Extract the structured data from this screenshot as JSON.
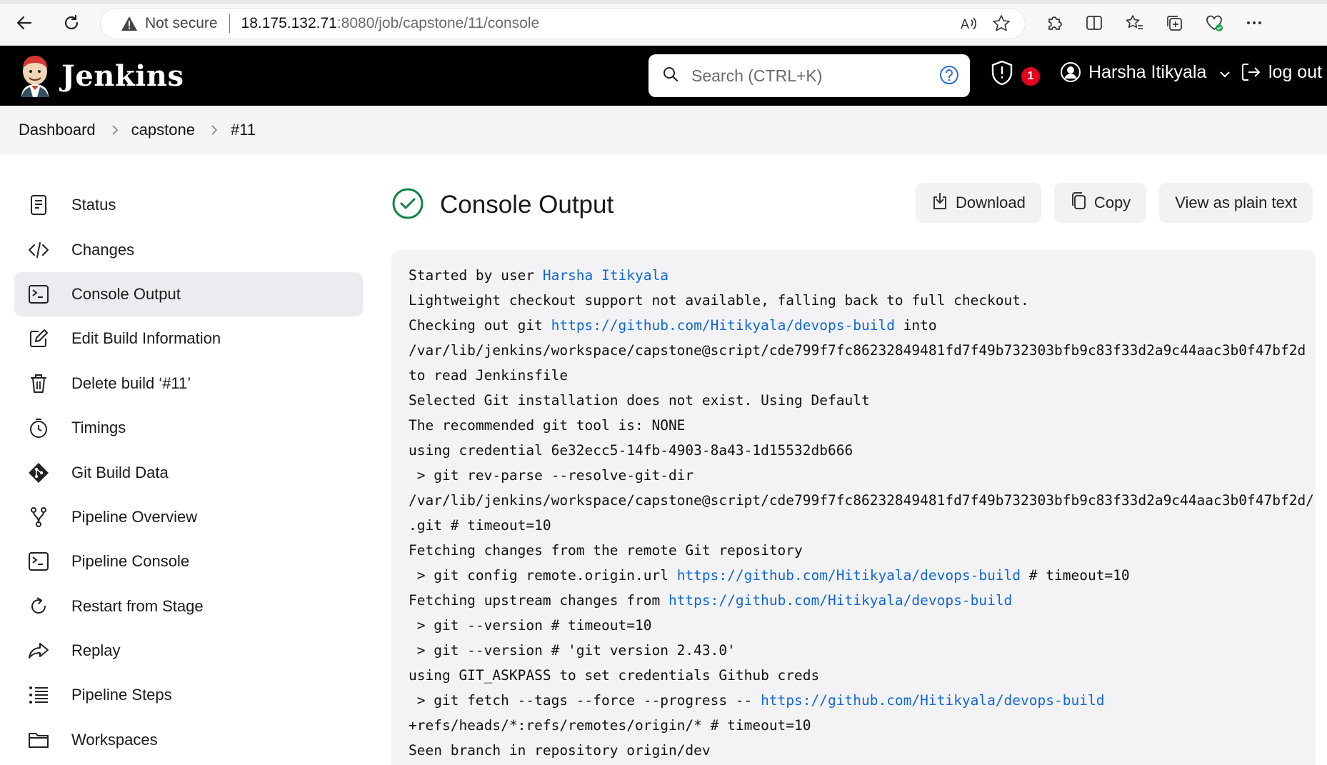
{
  "browser": {
    "security_label": "Not secure",
    "url_host": "18.175.132.71",
    "url_path": ":8080/job/capstone/11/console"
  },
  "header": {
    "brand": "Jenkins",
    "search_placeholder": "Search (CTRL+K)",
    "security_badge_count": "1",
    "user_name": "Harsha Itikyala",
    "logout_label": "log out"
  },
  "breadcrumb": [
    "Dashboard",
    "capstone",
    "#11"
  ],
  "sidebar": {
    "items": [
      {
        "label": "Status",
        "icon": "status-icon"
      },
      {
        "label": "Changes",
        "icon": "code-icon"
      },
      {
        "label": "Console Output",
        "icon": "terminal-icon",
        "active": true
      },
      {
        "label": "Edit Build Information",
        "icon": "edit-icon"
      },
      {
        "label": "Delete build ‘#11’",
        "icon": "trash-icon"
      },
      {
        "label": "Timings",
        "icon": "stopwatch-icon"
      },
      {
        "label": "Git Build Data",
        "icon": "git-icon"
      },
      {
        "label": "Pipeline Overview",
        "icon": "branch-icon"
      },
      {
        "label": "Pipeline Console",
        "icon": "terminal-icon"
      },
      {
        "label": "Restart from Stage",
        "icon": "restart-icon"
      },
      {
        "label": "Replay",
        "icon": "replay-icon"
      },
      {
        "label": "Pipeline Steps",
        "icon": "list-icon"
      },
      {
        "label": "Workspaces",
        "icon": "folder-icon"
      }
    ]
  },
  "main": {
    "title": "Console Output",
    "download_label": "Download",
    "copy_label": "Copy",
    "plain_label": "View as plain text"
  },
  "console": {
    "lines": [
      [
        {
          "t": "Started by user "
        },
        {
          "t": "Harsha Itikyala",
          "link": true
        }
      ],
      [
        {
          "t": "Lightweight checkout support not available, falling back to full checkout."
        }
      ],
      [
        {
          "t": "Checking out git "
        },
        {
          "t": "https://github.com/Hitikyala/devops-build",
          "link": true
        },
        {
          "t": " into"
        }
      ],
      [
        {
          "t": "/var/lib/jenkins/workspace/capstone@script/cde799f7fc86232849481fd7f49b732303bfb9c83f33d2a9c44aac3b0f47bf2d"
        }
      ],
      [
        {
          "t": "to read Jenkinsfile"
        }
      ],
      [
        {
          "t": "Selected Git installation does not exist. Using Default"
        }
      ],
      [
        {
          "t": "The recommended git tool is: NONE"
        }
      ],
      [
        {
          "t": "using credential 6e32ecc5-14fb-4903-8a43-1d15532db666"
        }
      ],
      [
        {
          "t": " > git rev-parse --resolve-git-dir"
        }
      ],
      [
        {
          "t": "/var/lib/jenkins/workspace/capstone@script/cde799f7fc86232849481fd7f49b732303bfb9c83f33d2a9c44aac3b0f47bf2d/"
        }
      ],
      [
        {
          "t": ".git # timeout=10"
        }
      ],
      [
        {
          "t": "Fetching changes from the remote Git repository"
        }
      ],
      [
        {
          "t": " > git config remote.origin.url "
        },
        {
          "t": "https://github.com/Hitikyala/devops-build",
          "link": true
        },
        {
          "t": " # timeout=10"
        }
      ],
      [
        {
          "t": "Fetching upstream changes from "
        },
        {
          "t": "https://github.com/Hitikyala/devops-build",
          "link": true
        }
      ],
      [
        {
          "t": " > git --version # timeout=10"
        }
      ],
      [
        {
          "t": " > git --version # 'git version 2.43.0'"
        }
      ],
      [
        {
          "t": "using GIT_ASKPASS to set credentials Github creds"
        }
      ],
      [
        {
          "t": " > git fetch --tags --force --progress -- "
        },
        {
          "t": "https://github.com/Hitikyala/devops-build",
          "link": true
        }
      ],
      [
        {
          "t": "+refs/heads/*:refs/remotes/origin/* # timeout=10"
        }
      ],
      [
        {
          "t": "Seen branch in repository origin/dev"
        }
      ]
    ]
  }
}
